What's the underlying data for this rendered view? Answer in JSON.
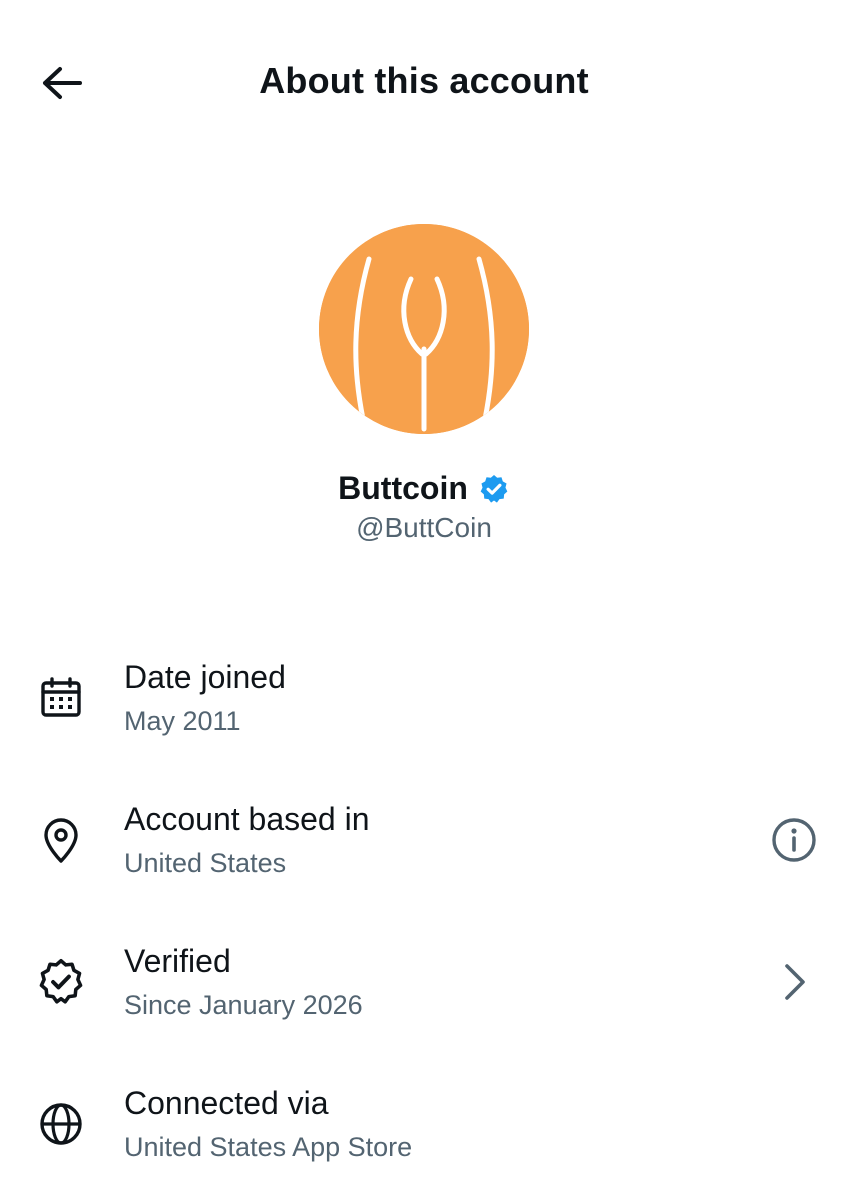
{
  "header": {
    "title": "About this account",
    "back_icon": "arrow-left-icon"
  },
  "profile": {
    "display_name": "Buttcoin",
    "handle": "@ButtCoin",
    "verified_badge_color": "#1d9bf0",
    "avatar_background": "#f7a14c"
  },
  "info": [
    {
      "title": "Date joined",
      "value": "May 2011",
      "icon": "calendar-icon"
    },
    {
      "title": "Account based in",
      "value": "United States",
      "icon": "location-pin-icon",
      "action_icon": "info-icon"
    },
    {
      "title": "Verified",
      "value": "Since January 2026",
      "icon": "verified-badge-outline-icon",
      "action_icon": "chevron-right-icon"
    },
    {
      "title": "Connected via",
      "value": "United States App Store",
      "icon": "globe-icon"
    }
  ],
  "colors": {
    "primary_text": "#0f1419",
    "secondary_text": "#536471"
  }
}
